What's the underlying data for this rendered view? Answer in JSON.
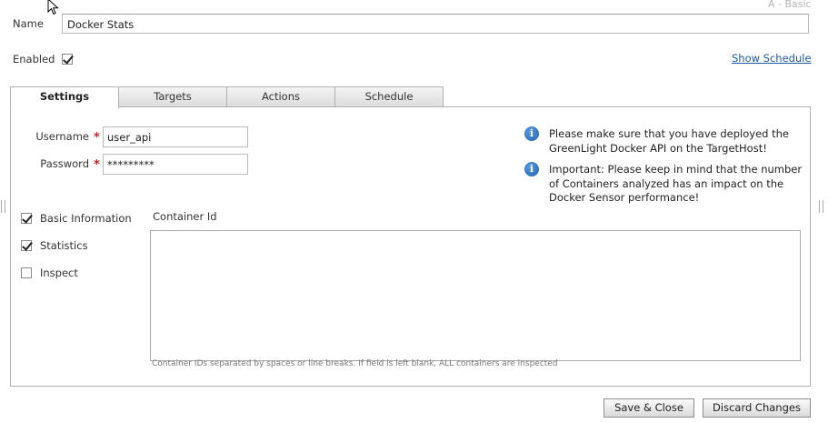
{
  "header": {
    "mode_label": "A - Basic",
    "name_label": "Name",
    "name_value": "Docker Stats",
    "enabled_label": "Enabled",
    "enabled_checked": true,
    "show_schedule_link": "Show Schedule"
  },
  "tabs": [
    {
      "label": "Settings",
      "active": true
    },
    {
      "label": "Targets",
      "active": false
    },
    {
      "label": "Actions",
      "active": false
    },
    {
      "label": "Schedule",
      "active": false
    }
  ],
  "settings": {
    "username_label": "Username",
    "username_value": "user_api",
    "password_label": "Password",
    "password_value": "*********",
    "required_mark": "*",
    "info_icon_glyph": "i",
    "info1": "Please make sure that you have deployed the GreenLight Docker API on the TargetHost!",
    "info2": "Important: Please keep in mind that the number of Containers analyzed has an impact on the Docker Sensor performance!",
    "options": [
      {
        "label": "Basic Information",
        "checked": true
      },
      {
        "label": "Statistics",
        "checked": true
      },
      {
        "label": "Inspect",
        "checked": false
      }
    ],
    "container_id_label": "Container Id",
    "container_id_value": "",
    "container_id_hint": "Container IDs separated by spaces or line breaks. If field is left blank, ALL containers are inspected"
  },
  "footer": {
    "save_label": "Save & Close",
    "discard_label": "Discard Changes"
  },
  "colors": {
    "link": "#1a5aa5",
    "required": "#cc2222",
    "info_icon": "#1c5fb0"
  }
}
